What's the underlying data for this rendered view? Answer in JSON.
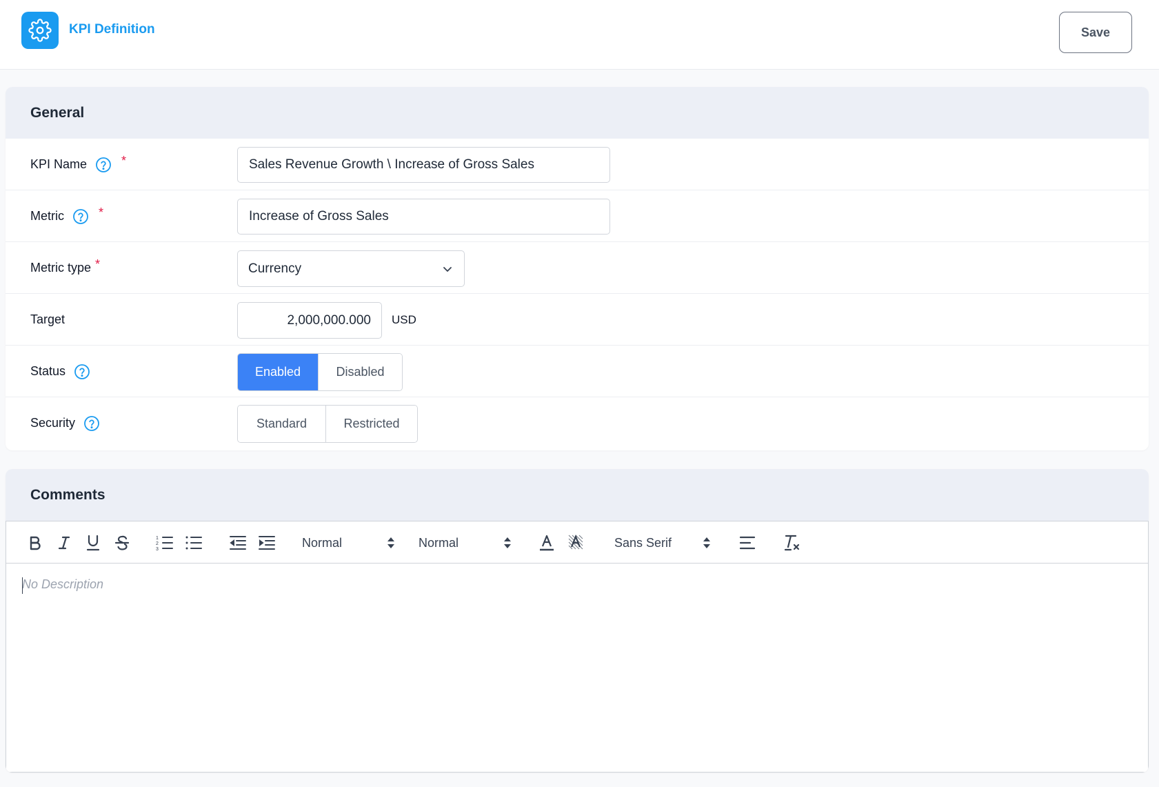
{
  "header": {
    "title": "KPI Definition",
    "app_icon": "gear-icon",
    "save_label": "Save"
  },
  "general": {
    "section_title": "General",
    "fields": {
      "kpi_name": {
        "label": "KPI Name",
        "required": true,
        "value": "Sales Revenue Growth \\ Increase of Gross Sales"
      },
      "metric": {
        "label": "Metric",
        "required": true,
        "value": "Increase of Gross Sales"
      },
      "metric_type": {
        "label": "Metric type",
        "required": true,
        "selected": "Currency"
      },
      "target": {
        "label": "Target",
        "value": "2,000,000.000",
        "unit": "USD"
      },
      "status": {
        "label": "Status",
        "options": [
          "Enabled",
          "Disabled"
        ],
        "selected": "Enabled"
      },
      "security": {
        "label": "Security",
        "options": [
          "Standard",
          "Restricted"
        ],
        "selected": ""
      }
    },
    "required_marker": "*"
  },
  "comments": {
    "section_title": "Comments",
    "toolbar": {
      "size_picker": "Normal",
      "header_picker": "Normal",
      "font_picker": "Sans Serif",
      "tools": [
        "bold-icon",
        "italic-icon",
        "underline-icon",
        "strikethrough-icon",
        "ordered-list-icon",
        "bullet-list-icon",
        "outdent-icon",
        "indent-icon",
        "text-color-icon",
        "highlight-color-icon",
        "align-icon",
        "clear-format-icon"
      ]
    },
    "placeholder": "No Description"
  },
  "colors": {
    "accent": "#1a9bf0",
    "active_toggle": "#3b82f6",
    "required": "#e11d48",
    "section_header_bg": "#eceff6"
  }
}
